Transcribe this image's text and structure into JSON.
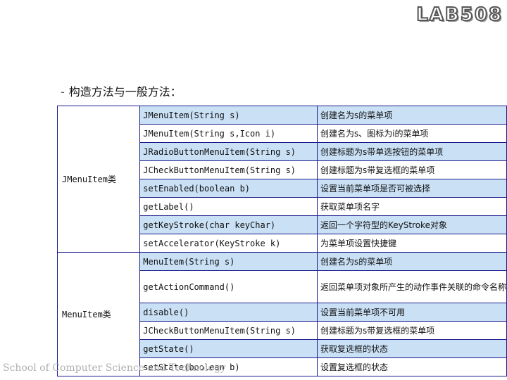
{
  "logo": "LAB508",
  "heading": {
    "bullet": "-",
    "text": "构造方法与一般方法："
  },
  "groups": [
    {
      "label": "JMenuItem类",
      "rows": [
        {
          "method": "JMenuItem(String s)",
          "desc": "创建名为s的菜单项"
        },
        {
          "method": "JMenuItem(String s,Icon i)",
          "desc": "创建名为s、图标为i的菜单项"
        },
        {
          "method": "JRadioButtonMenuItem(String s)",
          "desc": "创建标题为s带单选按钮的菜单项"
        },
        {
          "method": "JCheckButtonMenuItem(String s)",
          "desc": "创建标题为s带复选框的菜单项"
        },
        {
          "method": "setEnabled(boolean b)",
          "desc": "设置当前菜单项是否可被选择"
        },
        {
          "method": "getLabel()",
          "desc": "获取菜单项名字"
        },
        {
          "method": "getKeyStroke(char keyChar)",
          "desc": "返回一个字符型的KeyStroke对象"
        },
        {
          "method": "setAccelerator(KeyStroke k)",
          "desc": "为菜单项设置快捷键"
        }
      ]
    },
    {
      "label": "MenuItem类",
      "rows": [
        {
          "method": "MenuItem(String s)",
          "desc": "创建名为s的菜单项"
        },
        {
          "method": "getActionCommand()",
          "desc": "返回菜单项对象所产生的动作事件关联的命令名称"
        },
        {
          "method": "disable()",
          "desc": "设置当前菜单项不可用"
        },
        {
          "method": "JCheckButtonMenuItem(String s)",
          "desc": "创建标题为s带复选框的菜单项"
        },
        {
          "method": "getState()",
          "desc": "获取复选框的状态"
        },
        {
          "method": "setState(boolean b)",
          "desc": "设置复选框的状态"
        }
      ]
    }
  ],
  "footer": "School of Computer Science and Technology"
}
